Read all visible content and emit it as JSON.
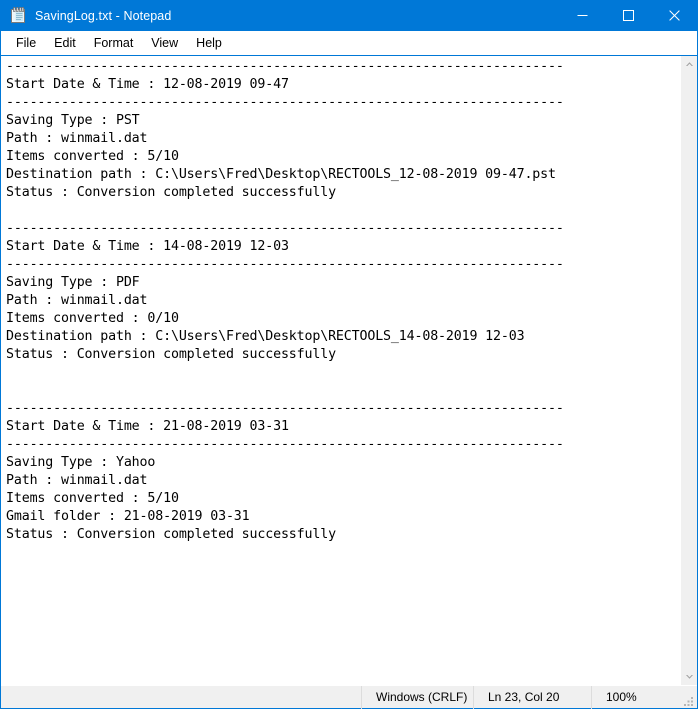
{
  "window": {
    "title": "SavingLog.txt - Notepad",
    "icon": "notepad-icon",
    "accent_color": "#0078d7",
    "controls": {
      "minimize": "Minimize",
      "maximize": "Maximize",
      "close": "Close"
    }
  },
  "menubar": {
    "items": [
      {
        "label": "File"
      },
      {
        "label": "Edit"
      },
      {
        "label": "Format"
      },
      {
        "label": "View"
      },
      {
        "label": "Help"
      }
    ]
  },
  "document": {
    "lines": [
      "-----------------------------------------------------------------------",
      "Start Date & Time : 12-08-2019 09-47",
      "-----------------------------------------------------------------------",
      "Saving Type : PST",
      "Path : winmail.dat",
      "Items converted : 5/10",
      "Destination path : C:\\Users\\Fred\\Desktop\\RECTOOLS_12-08-2019 09-47.pst",
      "Status : Conversion completed successfully",
      "",
      "-----------------------------------------------------------------------",
      "Start Date & Time : 14-08-2019 12-03",
      "-----------------------------------------------------------------------",
      "Saving Type : PDF",
      "Path : winmail.dat",
      "Items converted : 0/10",
      "Destination path : C:\\Users\\Fred\\Desktop\\RECTOOLS_14-08-2019 12-03",
      "Status : Conversion completed successfully",
      "",
      "",
      "-----------------------------------------------------------------------",
      "Start Date & Time : 21-08-2019 03-31",
      "-----------------------------------------------------------------------",
      "Saving Type : Yahoo",
      "Path : winmail.dat",
      "Items converted : 5/10",
      "Gmail folder : 21-08-2019 03-31",
      "Status : Conversion completed successfully"
    ]
  },
  "scrollbar": {
    "up_arrow": "chevron-up-icon",
    "down_arrow": "chevron-down-icon"
  },
  "statusbar": {
    "encoding": "Windows (CRLF)",
    "position": "Ln 23, Col 20",
    "zoom": "100%"
  }
}
